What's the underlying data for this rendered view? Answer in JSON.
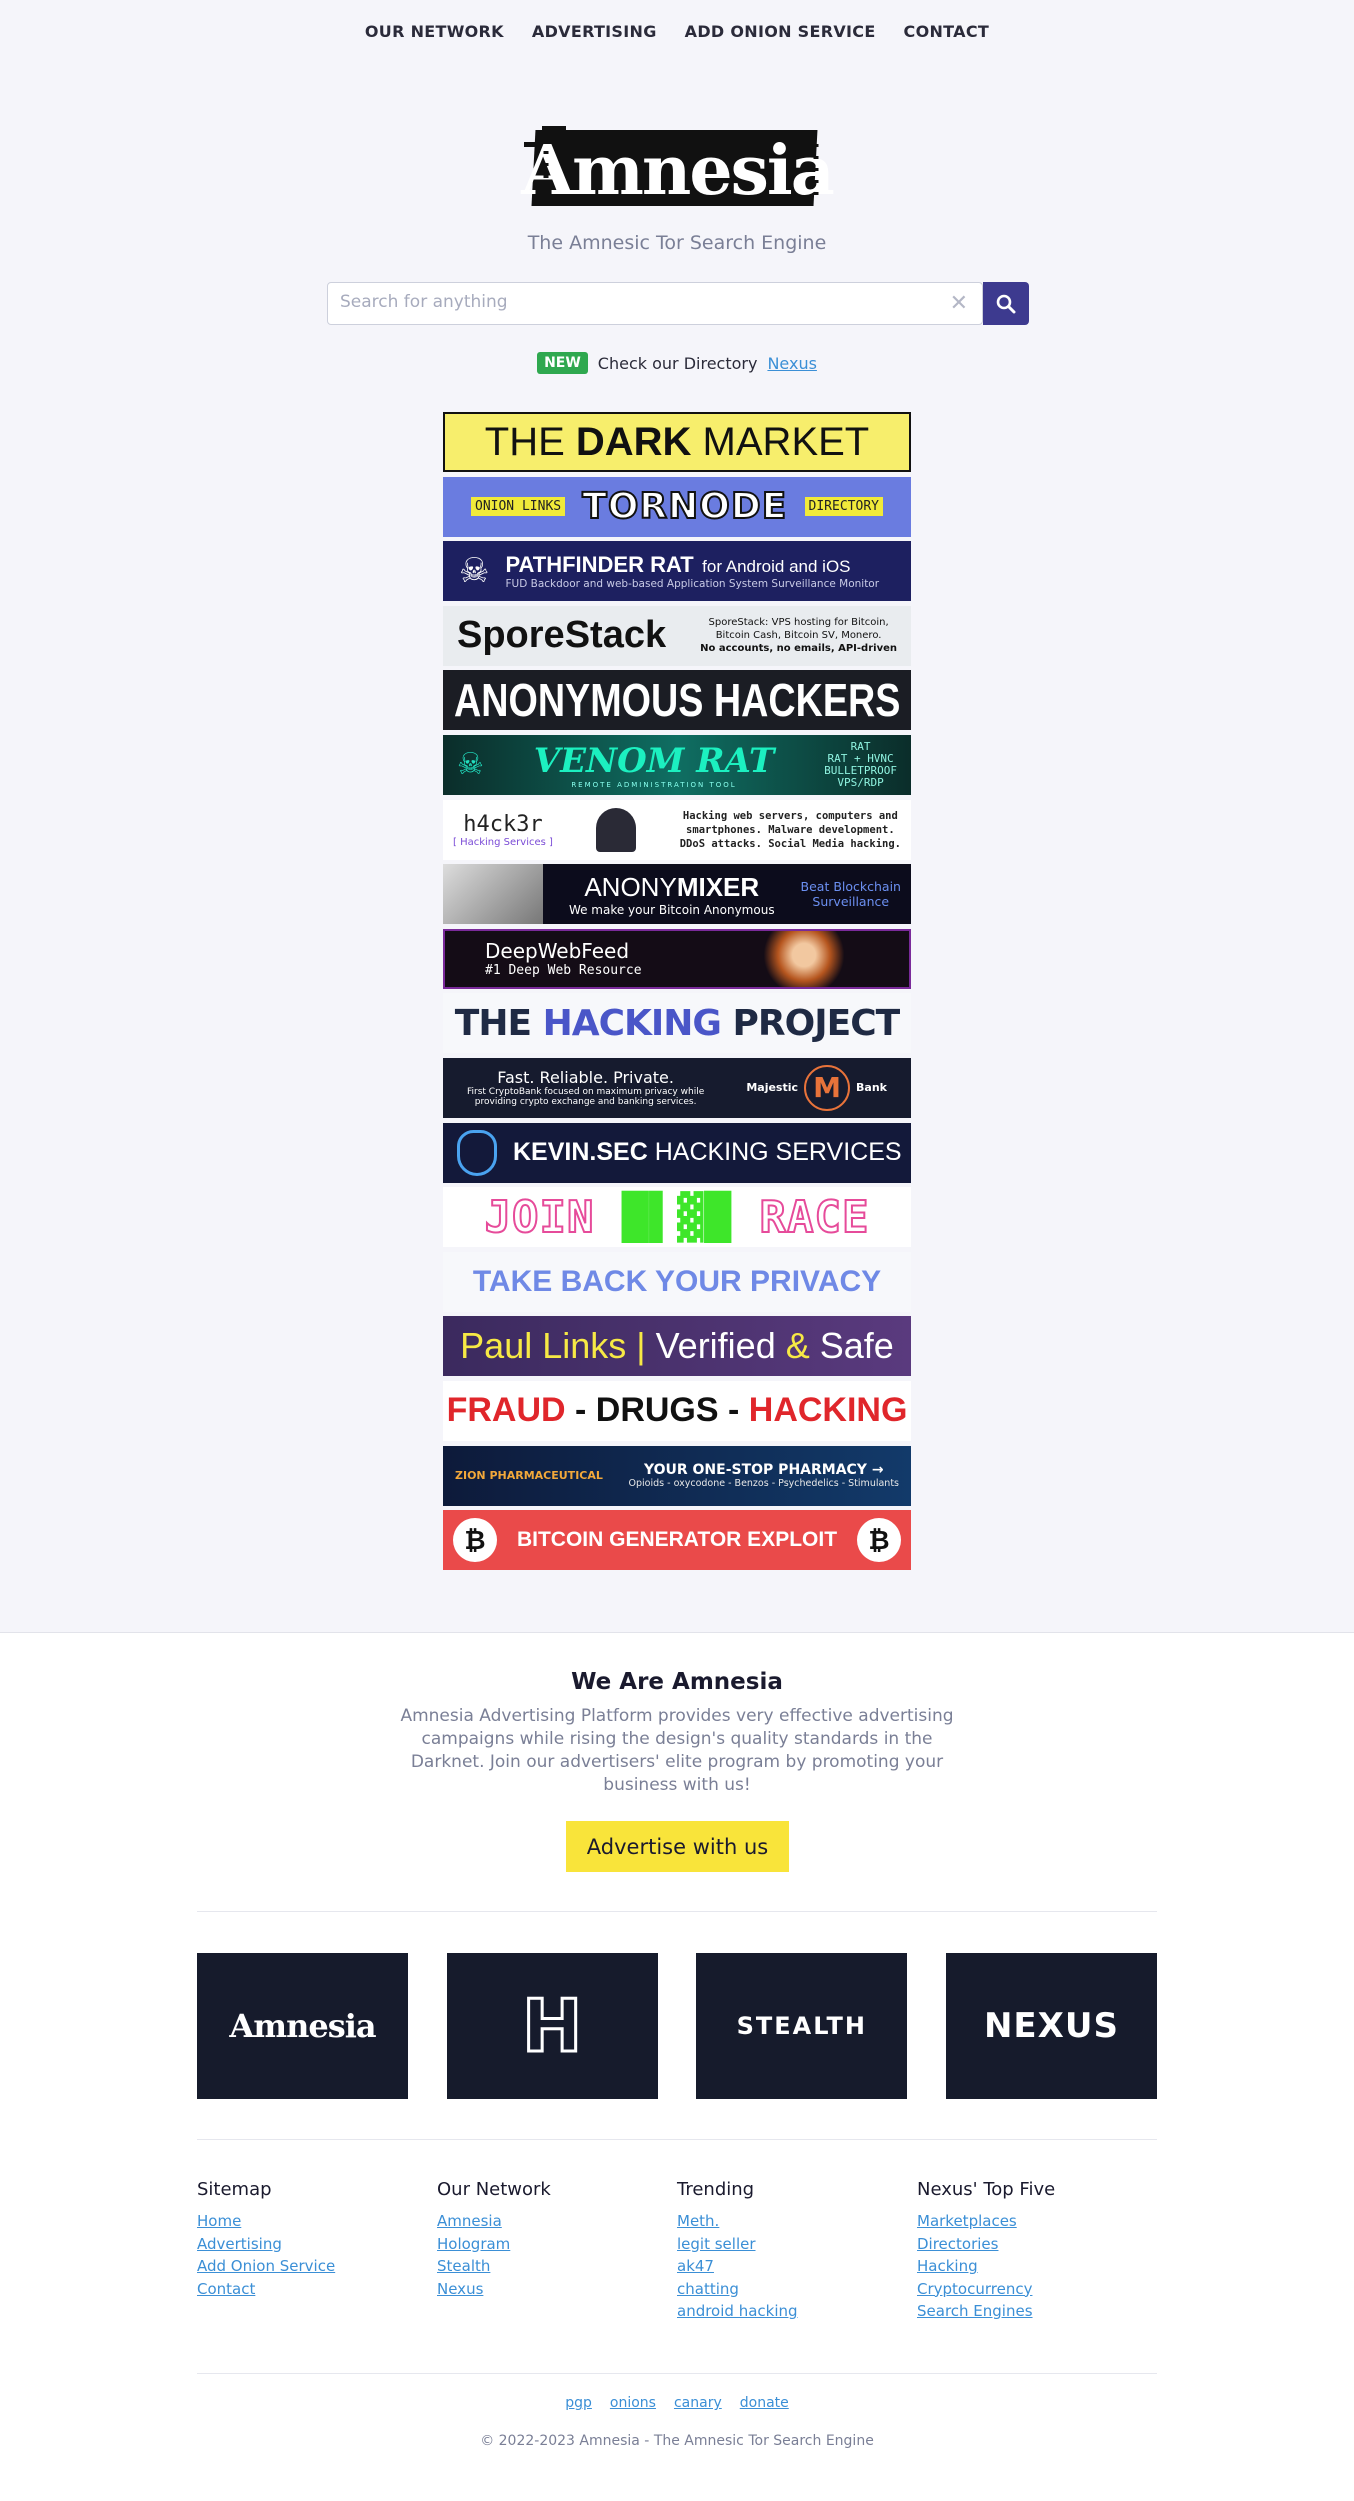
{
  "nav": [
    "OUR NETWORK",
    "ADVERTISING",
    "ADD ONION SERVICE",
    "CONTACT"
  ],
  "logo_text": "Amnesia",
  "tagline": "The Amnesic Tor Search Engine",
  "search": {
    "placeholder": "Search for anything"
  },
  "notice": {
    "badge": "NEW",
    "text": "Check our Directory",
    "link": "Nexus"
  },
  "banners": {
    "dark_market": {
      "pre": "THE ",
      "bold": "DARK",
      "post": " MARKET"
    },
    "tornode": {
      "left": "ONION LINKS",
      "center": "TORNODE",
      "right": "DIRECTORY"
    },
    "pathfinder": {
      "title": "PATHFINDER RAT",
      "suffix": "for Android and iOS",
      "sub": "FUD Backdoor and web-based Application System Surveillance Monitor"
    },
    "sporestack": {
      "name": "SporeStack",
      "line1": "SporeStack: VPS hosting for Bitcoin,",
      "line2": "Bitcoin Cash, Bitcoin SV, Monero.",
      "line3": "No accounts, no emails, API-driven"
    },
    "anon_hackers": "ANONYMOUS HACKERS",
    "venom": {
      "name": "VENOM RAT",
      "sub": "REMOTE ADMINISTRATION TOOL",
      "r1": "RAT",
      "r2": "RAT + HVNC",
      "r3": "BULLETPROOF",
      "r4": "VPS/RDP"
    },
    "h4ck3r": {
      "name": "h4ck3r",
      "tag": "[ Hacking Services ]",
      "l1": "Hacking web servers, computers and",
      "l2": "smartphones. Malware development.",
      "l3": "DDoS attacks. Social Media hacking."
    },
    "anonymixer": {
      "pre": "ANONY",
      "bold": "MIXER",
      "sub": "We make your Bitcoin Anonymous",
      "right1": "Beat Blockchain",
      "right2": "Surveillance"
    },
    "deepwebfeed": {
      "name": "DeepWebFeed",
      "sub": "#1 Deep Web Resource"
    },
    "hacking_project": {
      "pre": "THE ",
      "mid": "HACKING",
      "post": " PROJECT"
    },
    "majestic": {
      "title": "Fast. Reliable. Private.",
      "l1": "First CryptoBank focused on maximum privacy while",
      "l2": "providing crypto exchange and banking services.",
      "brand1": "Majestic",
      "brand2": "Bank"
    },
    "kevin": {
      "bold": "KEVIN.SEC",
      "rest": " HACKING SERVICES"
    },
    "join_race": {
      "pre": "JOIN ",
      "mid": "█▌▓█",
      "post": " RACE"
    },
    "privacy": "TAKE BACK YOUR PRIVACY",
    "paul": {
      "a": "Paul Links",
      "b": "Verified",
      "c": "&",
      "d": "Safe"
    },
    "fraud": {
      "a": "FRAUD",
      "b": " - DRUGS - ",
      "c": "HACKING"
    },
    "zion": {
      "brand": "ZION PHARMACEUTICAL",
      "head": "YOUR ONE-STOP PHARMACY →",
      "sub": "Opioids - oxycodone - Benzos - Psychedelics - Stimulants"
    },
    "btc": {
      "text": "BITCOIN GENERATOR EXPLOIT"
    }
  },
  "about": {
    "title": "We Are Amnesia",
    "text": "Amnesia Advertising Platform provides very effective advertising campaigns while rising the design's quality standards in the Darknet. Join our advertisers' elite program by promoting your business with us!",
    "button": "Advertise with us"
  },
  "tiles": [
    "Amnesia",
    "H",
    "STEALTH",
    "NEXUS"
  ],
  "columns": [
    {
      "title": "Sitemap",
      "links": [
        "Home",
        "Advertising",
        "Add Onion Service",
        "Contact"
      ]
    },
    {
      "title": "Our Network",
      "links": [
        "Amnesia",
        "Hologram",
        "Stealth",
        "Nexus"
      ]
    },
    {
      "title": "Trending",
      "links": [
        "Meth.",
        "legit seller",
        "ak47",
        "chatting",
        "android hacking"
      ]
    },
    {
      "title": "Nexus' Top Five",
      "links": [
        "Marketplaces",
        "Directories",
        "Hacking",
        "Cryptocurrency",
        "Search Engines"
      ]
    }
  ],
  "footer_links": [
    "pgp",
    "onions",
    "canary",
    "donate"
  ],
  "copyright": "© 2022-2023 Amnesia - The Amnesic Tor Search Engine"
}
